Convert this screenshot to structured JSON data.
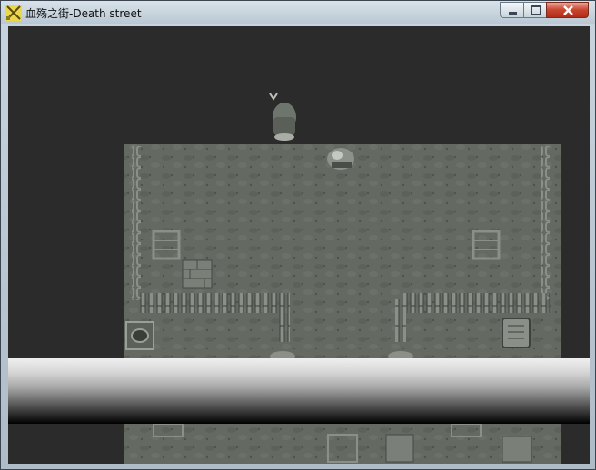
{
  "window": {
    "title": "血殇之街-Death street"
  },
  "controls": {
    "minimize": "minimize",
    "maximize": "maximize",
    "close": "close"
  },
  "colors": {
    "background": "#2b2b2b",
    "floor": "#646a62",
    "fence": "#8a8f87",
    "message_box_top": "#efefef",
    "message_box_bottom": "#000000"
  }
}
